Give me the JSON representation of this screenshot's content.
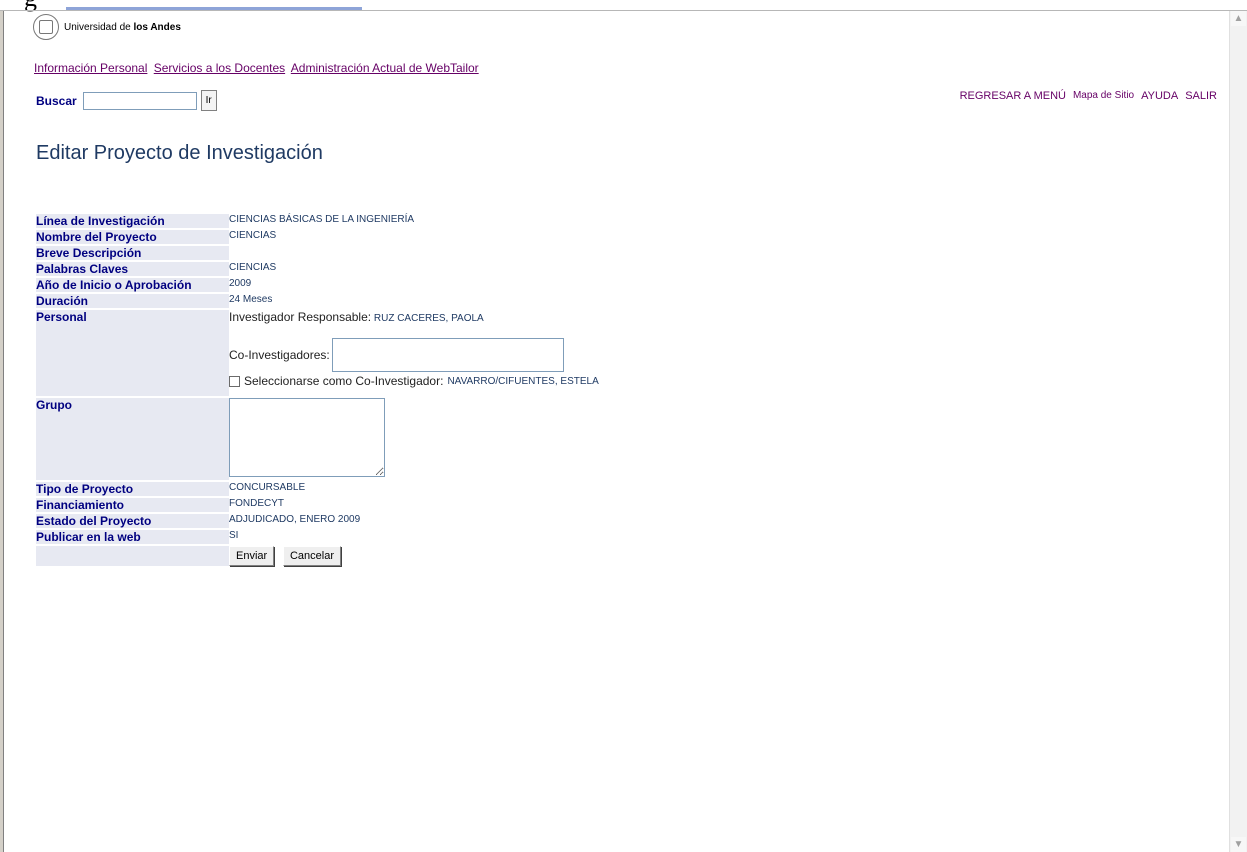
{
  "institution": {
    "prefix": "Universidad de ",
    "name_bold": "los Andes"
  },
  "top_nav": [
    "Información Personal",
    "Servicios a los Docentes",
    "Administración Actual de WebTailor"
  ],
  "search": {
    "label": "Buscar",
    "value": "",
    "go_label": "Ir"
  },
  "right_nav": {
    "back": "REGRESAR A MENÚ",
    "sitemap": "Mapa de Sitio",
    "help": "AYUDA",
    "exit": "SALIR"
  },
  "page_title": "Editar Proyecto de Investigación",
  "form": {
    "linea_label": "Línea de Investigación",
    "linea_value": "CIENCIAS BÁSICAS DE LA INGENIERÍA",
    "nombre_label": "Nombre del Proyecto",
    "nombre_value": "CIENCIAS",
    "breve_label": "Breve Descripción",
    "breve_value": "",
    "palabras_label": "Palabras Claves",
    "palabras_value": "CIENCIAS",
    "anio_label": "Año de Inicio o Aprobación",
    "anio_value": "2009",
    "duracion_label": "Duración",
    "duracion_value": "24 Meses",
    "personal_label": "Personal",
    "inv_resp_label": "Investigador Responsable:",
    "inv_resp_value": "RUZ CACERES, PAOLA",
    "coinv_label": "Co-Investigadores:",
    "coinv_value": "",
    "select_coinv_label": "Seleccionarse como Co-Investigador:",
    "select_coinv_value": "NAVARRO/CIFUENTES, ESTELA",
    "select_coinv_checked": false,
    "grupo_label": "Grupo",
    "grupo_value": "",
    "tipo_label": "Tipo de Proyecto",
    "tipo_value": "CONCURSABLE",
    "financ_label": "Financiamiento",
    "financ_value": "FONDECYT",
    "estado_label": "Estado del Proyecto",
    "estado_value": "ADJUDICADO, ENERO 2009",
    "publicar_label": "Publicar en la web",
    "publicar_value": "SI",
    "submit_label": "Enviar",
    "cancel_label": "Cancelar"
  },
  "icons": {
    "logo": "university-seal-icon",
    "scroll_up": "scroll-up-arrow-icon",
    "scroll_down": "scroll-down-arrow-icon"
  },
  "colors": {
    "link": "#660066",
    "label": "#000080",
    "title": "#1f3a63",
    "label_bg": "#e7e9f2"
  }
}
